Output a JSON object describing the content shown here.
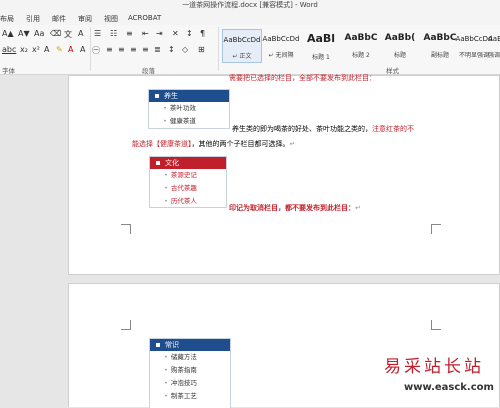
{
  "window": {
    "title": "一道茶网操作流程.docx [兼容模式] - Word"
  },
  "menu": [
    "布局",
    "引用",
    "邮件",
    "审阅",
    "视图",
    "ACROBAT"
  ],
  "ribbon": {
    "font_group_label": "字体",
    "paragraph_group_label": "段落",
    "styles_group_label": "样式",
    "styles": [
      {
        "preview": "AaBbCcDd",
        "name": "正文",
        "selected": true
      },
      {
        "preview": "AaBbCcDd",
        "name": "无间隔"
      },
      {
        "preview": "AaBl",
        "name": "标题 1"
      },
      {
        "preview": "AaBbC",
        "name": "标题 2"
      },
      {
        "preview": "AaBb(",
        "name": "标题"
      },
      {
        "preview": "AaBbC",
        "name": "副标题"
      },
      {
        "preview": "AaBbCcDd",
        "name": "不明显强调"
      },
      {
        "preview": "AaBbCcl",
        "name": "强调"
      }
    ]
  },
  "doc": {
    "top_red_fragment": "需要把已选择的栏目，全部不要发布到此栏目：",
    "nav1": {
      "header": "养生",
      "items": [
        "茶叶功效",
        "健康茶道"
      ]
    },
    "para1_part1": "养生类的即为喝茶的好处、茶叶功能之类的，",
    "para1_red": "注意红茶的不",
    "para2_red": "能选择【健康茶道】",
    "para2_rest": "，其他的两个子栏目都可选择。",
    "nav2": {
      "header": "文化",
      "items": [
        "茶源史记",
        "古代茶趣",
        "历代茶人"
      ]
    },
    "red_instruction": "印记为取消栏目，都不要发布到此栏目：",
    "nav3": {
      "header": "常识",
      "items": [
        "储藏方法",
        "购茶指南",
        "冲泡技巧",
        "制茶工艺"
      ]
    }
  },
  "watermark": {
    "text": "易采站长站",
    "url": "www.easck.com"
  }
}
